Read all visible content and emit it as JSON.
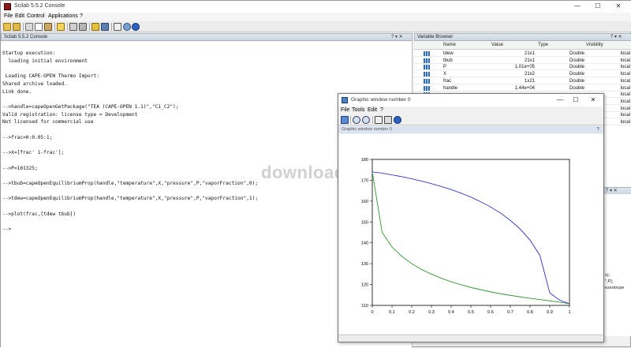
{
  "window": {
    "title": "Scilab 5.5.2 Console",
    "minimize": "—",
    "maximize": "☐",
    "close": "✕"
  },
  "menu": [
    "File",
    "Edit",
    "Control",
    "Applications",
    "?"
  ],
  "console_panel": {
    "title": "Scilab 5.5.2 Console",
    "controls": "? ▾ ✕",
    "lines": [
      "Startup execution:",
      "  loading initial environment",
      "",
      " Loading CAPE-OPEN Thermo Import:",
      "Shared archive loaded.",
      "Link done.",
      "",
      "-->handle=capeOpenGetPackage(\"TEA (CAPE-OPEN 1.1)\",\"C1_C2\");",
      "Valid registration: license type = Development",
      "Not licensed for commercial use",
      "",
      "-->frac=0:0.05:1;",
      "",
      "-->X=[frac' 1-frac'];",
      "",
      "-->P=101325;",
      "",
      "-->tbub=capeOpenEquilibriumProp(handle,\"temperature\",X,\"pressure\",P,\"vaporFraction\",0);",
      "",
      "-->tdew=capeOpenEquilibriumProp(handle,\"temperature\",X,\"pressure\",P,\"vaporFraction\",1);",
      "",
      "-->plot(frac,[tdew tbub])",
      "",
      "-->"
    ]
  },
  "variable_browser": {
    "title": "Variable Browser",
    "controls": "? ▾ ✕",
    "columns": [
      "Name",
      "Value",
      "Type",
      "Visibility"
    ],
    "rows": [
      {
        "name": "tdew",
        "value": "21x1",
        "type": "Double",
        "visibility": "local"
      },
      {
        "name": "tbub",
        "value": "21x1",
        "type": "Double",
        "visibility": "local"
      },
      {
        "name": "P",
        "value": "1.01e+05",
        "type": "Double",
        "visibility": "local"
      },
      {
        "name": "X",
        "value": "21x2",
        "type": "Double",
        "visibility": "local"
      },
      {
        "name": "frac",
        "value": "1x21",
        "type": "Double",
        "visibility": "local"
      },
      {
        "name": "handle",
        "value": "1.44e+04",
        "type": "Double",
        "visibility": "local"
      },
      {
        "name": "",
        "value": "",
        "type": "",
        "visibility": "local"
      },
      {
        "name": "",
        "value": "",
        "type": "",
        "visibility": "local"
      },
      {
        "name": "",
        "value": "",
        "type": "",
        "visibility": "local"
      },
      {
        "name": "",
        "value": "",
        "type": "",
        "visibility": "local"
      },
      {
        "name": "",
        "value": "",
        "type": "",
        "visibility": "local"
      }
    ]
  },
  "history_fragments": [
    "s);",
    "\",P];",
    "ezeotrope"
  ],
  "watermark": "download",
  "graphic_window": {
    "title": "Graphic window number 0",
    "minimize": "—",
    "maximize": "☐",
    "close": "✕",
    "menu": [
      "File",
      "Tools",
      "Edit",
      "?"
    ],
    "info": "Graphic window number 0",
    "info_help": "?"
  },
  "chart_data": {
    "type": "line",
    "title": "",
    "xlabel": "",
    "ylabel": "",
    "xlim": [
      0,
      1
    ],
    "ylim": [
      110,
      180
    ],
    "xticks": [
      "0",
      "0.1",
      "0.2",
      "0.3",
      "0.4",
      "0.5",
      "0.6",
      "0.7",
      "0.8",
      "0.9",
      "1"
    ],
    "yticks": [
      "110",
      "120",
      "130",
      "140",
      "150",
      "160",
      "170",
      "180"
    ],
    "x": [
      0,
      0.05,
      0.1,
      0.15,
      0.2,
      0.25,
      0.3,
      0.35,
      0.4,
      0.45,
      0.5,
      0.55,
      0.6,
      0.65,
      0.7,
      0.75,
      0.8,
      0.85,
      0.9,
      0.95,
      1
    ],
    "series": [
      {
        "color": "#1a1ac8",
        "values": [
          174.0,
          173.4,
          172.6,
          171.7,
          170.7,
          169.6,
          168.4,
          167.0,
          165.5,
          163.8,
          161.9,
          159.7,
          157.2,
          154.3,
          150.8,
          146.6,
          141.3,
          134.0,
          116.0,
          112.5,
          110.8
        ]
      },
      {
        "color": "#1a8a1a",
        "values": [
          174.0,
          145.0,
          138.0,
          133.5,
          130.0,
          127.2,
          125.0,
          123.0,
          121.3,
          119.9,
          118.6,
          117.5,
          116.5,
          115.6,
          114.8,
          114.1,
          113.4,
          112.8,
          112.2,
          111.5,
          110.8
        ]
      }
    ]
  }
}
